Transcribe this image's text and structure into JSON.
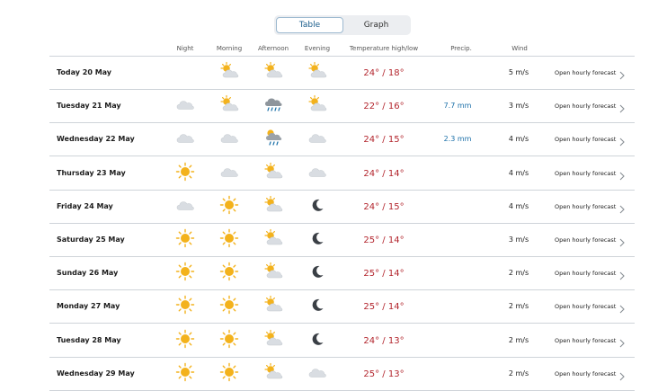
{
  "view_toggle": {
    "table_label": "Table",
    "graph_label": "Graph"
  },
  "columns": {
    "night": "Night",
    "morning": "Morning",
    "afternoon": "Afternoon",
    "evening": "Evening",
    "temperature": "Temperature high/low",
    "precip": "Precip.",
    "wind": "Wind"
  },
  "link_label": "Open hourly forecast",
  "rows": [
    {
      "date": "Today 20 May",
      "icons": [
        "",
        "partly-cloudy-icon",
        "partly-cloudy-icon",
        "partly-cloudy-icon"
      ],
      "temp": "24° / 18°",
      "precip": "",
      "wind": "5 m/s"
    },
    {
      "date": "Tuesday 21 May",
      "icons": [
        "cloud-icon",
        "partly-cloudy-icon",
        "rain-cloud-icon",
        "partly-cloudy-icon"
      ],
      "temp": "22° / 16°",
      "precip": "7.7 mm",
      "wind": "3 m/s"
    },
    {
      "date": "Wednesday 22 May",
      "icons": [
        "cloud-icon",
        "cloud-icon",
        "sun-rain-cloud-icon",
        "cloud-icon"
      ],
      "temp": "24° / 15°",
      "precip": "2.3 mm",
      "wind": "4 m/s"
    },
    {
      "date": "Thursday 23 May",
      "icons": [
        "sun-icon",
        "cloud-icon",
        "partly-cloudy-icon",
        "cloud-icon"
      ],
      "temp": "24° / 14°",
      "precip": "",
      "wind": "4 m/s"
    },
    {
      "date": "Friday 24 May",
      "icons": [
        "cloud-icon",
        "sun-icon",
        "partly-cloudy-icon",
        "moon-icon"
      ],
      "temp": "24° / 15°",
      "precip": "",
      "wind": "4 m/s"
    },
    {
      "date": "Saturday 25 May",
      "icons": [
        "sun-icon",
        "sun-icon",
        "partly-cloudy-icon",
        "moon-icon"
      ],
      "temp": "25° / 14°",
      "precip": "",
      "wind": "3 m/s"
    },
    {
      "date": "Sunday 26 May",
      "icons": [
        "sun-icon",
        "sun-icon",
        "partly-cloudy-icon",
        "moon-icon"
      ],
      "temp": "25° / 14°",
      "precip": "",
      "wind": "2 m/s"
    },
    {
      "date": "Monday 27 May",
      "icons": [
        "sun-icon",
        "sun-icon",
        "partly-cloudy-icon",
        "moon-icon"
      ],
      "temp": "25° / 14°",
      "precip": "",
      "wind": "2 m/s"
    },
    {
      "date": "Tuesday 28 May",
      "icons": [
        "sun-icon",
        "sun-icon",
        "partly-cloudy-icon",
        "moon-icon"
      ],
      "temp": "24° / 13°",
      "precip": "",
      "wind": "2 m/s"
    },
    {
      "date": "Wednesday 29 May",
      "icons": [
        "sun-icon",
        "sun-icon",
        "partly-cloudy-icon",
        "cloud-icon"
      ],
      "temp": "25° / 13°",
      "precip": "",
      "wind": "2 m/s"
    }
  ],
  "colors": {
    "temperature": "#b3262e",
    "precipitation": "#1a6fa8",
    "sun": "#f3b21c",
    "cloud": "#d9dde2",
    "divider": "#cfd4d9"
  }
}
